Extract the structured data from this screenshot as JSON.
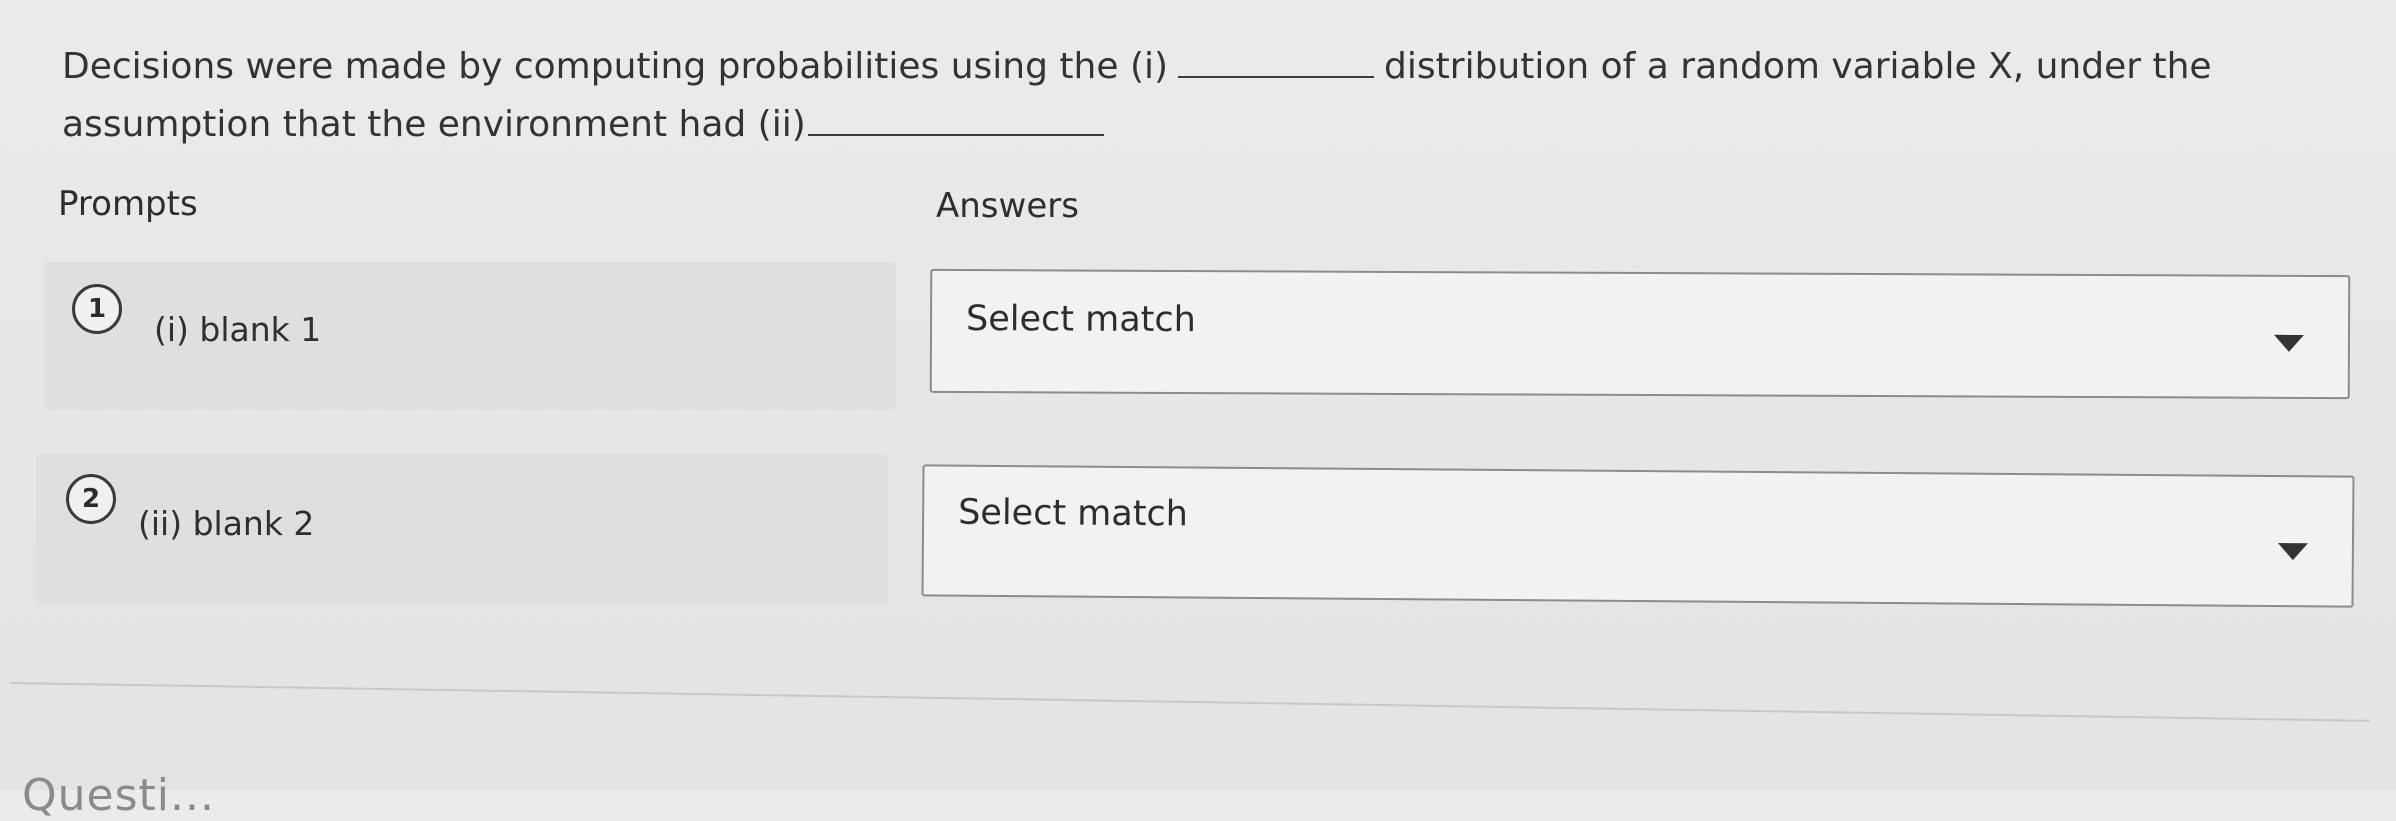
{
  "question": {
    "part1": "Decisions were made by computing probabilities using the (i)",
    "part2": "distribution of a random variable X, under the assumption that the environment had (ii)"
  },
  "columns": {
    "prompts": "Prompts",
    "answers": "Answers"
  },
  "items": [
    {
      "number": "1",
      "label": "(i) blank 1",
      "select_value": "Select match"
    },
    {
      "number": "2",
      "label": "(ii) blank 2",
      "select_value": "Select match"
    }
  ],
  "next_section": {
    "heading": "Questi..."
  },
  "icons": {
    "dropdown": "caret-down-icon"
  }
}
